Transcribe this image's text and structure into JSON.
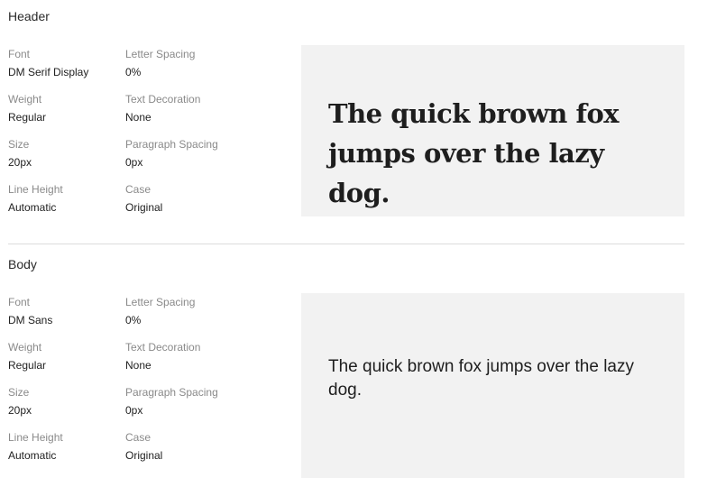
{
  "header_section": {
    "title": "Header",
    "properties": [
      {
        "label": "Font",
        "value": "DM Serif Display"
      },
      {
        "label": "Letter Spacing",
        "value": "0%"
      },
      {
        "label": "Weight",
        "value": "Regular"
      },
      {
        "label": "Text Decoration",
        "value": "None"
      },
      {
        "label": "Size",
        "value": "20px"
      },
      {
        "label": "Paragraph Spacing",
        "value": "0px"
      },
      {
        "label": "Line Height",
        "value": "Automatic"
      },
      {
        "label": "Case",
        "value": "Original"
      }
    ],
    "preview_text": "The quick brown fox jumps over the lazy dog."
  },
  "body_section": {
    "title": "Body",
    "properties": [
      {
        "label": "Font",
        "value": "DM Sans"
      },
      {
        "label": "Letter Spacing",
        "value": "0%"
      },
      {
        "label": "Weight",
        "value": "Regular"
      },
      {
        "label": "Text Decoration",
        "value": "None"
      },
      {
        "label": "Size",
        "value": "20px"
      },
      {
        "label": "Paragraph Spacing",
        "value": "0px"
      },
      {
        "label": "Line Height",
        "value": "Automatic"
      },
      {
        "label": "Case",
        "value": "Original"
      }
    ],
    "preview_text": "The quick brown fox jumps over the lazy dog."
  },
  "colors": {
    "preview_background": "#f2f2f2",
    "label": "#8a8a8a",
    "value": "#222222",
    "divider": "#dcdcdc"
  }
}
